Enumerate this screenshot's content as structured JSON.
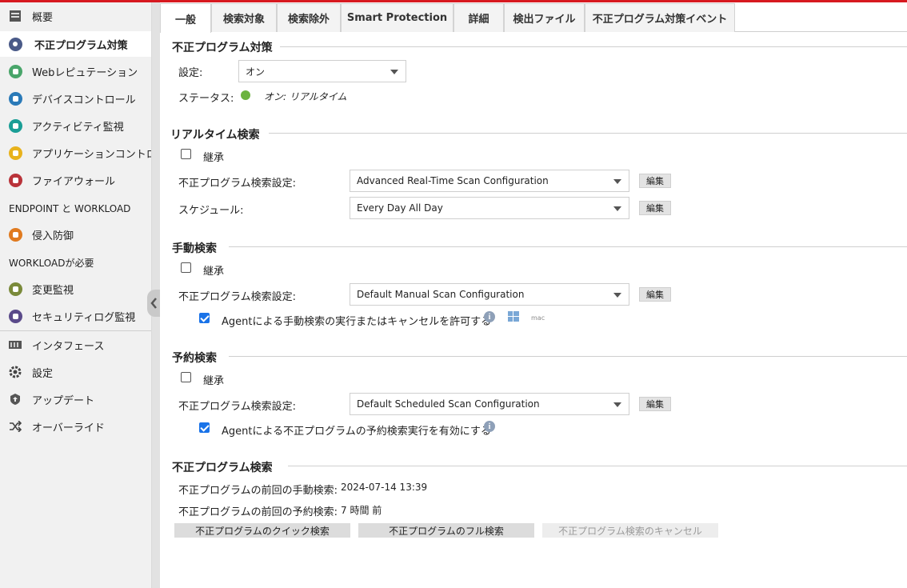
{
  "sidebar": {
    "items": [
      {
        "label": "概要"
      },
      {
        "label": "不正プログラム対策"
      },
      {
        "label": "Webレピュテーション"
      },
      {
        "label": "デバイスコントロール"
      },
      {
        "label": "アクティビティ監視"
      },
      {
        "label": "アプリケーションコントロール"
      },
      {
        "label": "ファイアウォール"
      },
      {
        "label": "侵入防御"
      },
      {
        "label": "変更監視"
      },
      {
        "label": "セキュリティログ監視"
      },
      {
        "label": "インタフェース"
      },
      {
        "label": "設定"
      },
      {
        "label": "アップデート"
      },
      {
        "label": "オーバーライド"
      }
    ],
    "sections": {
      "endpoint_workload": "ENDPOINT と WORKLOAD",
      "workload_required": "WORKLOADが必要"
    }
  },
  "tabs": [
    "一般",
    "検索対象",
    "検索除外",
    "Smart Protection",
    "詳細",
    "検出ファイル",
    "不正プログラム対策イベント"
  ],
  "antimalware": {
    "title": "不正プログラム対策",
    "setting_label": "設定:",
    "setting_value": "オン",
    "status_label": "ステータス:",
    "status_value": "オン: リアルタイム",
    "status_color": "#6cb33f"
  },
  "realtime": {
    "title": "リアルタイム検索",
    "inherit_label": "継承",
    "config_label": "不正プログラム検索設定:",
    "config_value": "Advanced Real-Time Scan Configuration",
    "schedule_label": "スケジュール:",
    "schedule_value": "Every Day All Day",
    "edit_label": "編集"
  },
  "manual": {
    "title": "手動検索",
    "inherit_label": "継承",
    "config_label": "不正プログラム検索設定:",
    "config_value": "Default Manual Scan Configuration",
    "edit_label": "編集",
    "allow_label": "Agentによる手動検索の実行またはキャンセルを許可する",
    "mac_label": "mac"
  },
  "scheduled": {
    "title": "予約検索",
    "inherit_label": "継承",
    "config_label": "不正プログラム検索設定:",
    "config_value": "Default Scheduled Scan Configuration",
    "edit_label": "編集",
    "allow_label": "Agentによる不正プログラムの予約検索実行を有効にする"
  },
  "scan": {
    "title": "不正プログラム検索",
    "last_manual_label": "不正プログラムの前回の手動検索:",
    "last_manual_value": "2024-07-14 13:39",
    "last_scheduled_label": "不正プログラムの前回の予約検索:",
    "last_scheduled_value": "7 時間 前",
    "quick_btn": "不正プログラムのクイック検索",
    "full_btn": "不正プログラムのフル検索",
    "cancel_btn": "不正プログラム検索のキャンセル"
  }
}
